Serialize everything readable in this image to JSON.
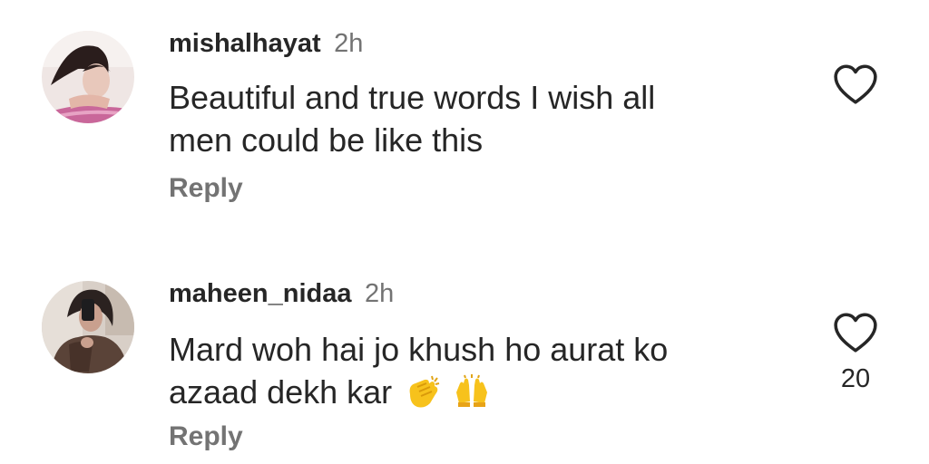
{
  "comments": [
    {
      "username": "mishalhayat",
      "time": "2h",
      "text_line1": "Beautiful and true words I wish all",
      "text_line2": "men could be like this",
      "reply_label": "Reply",
      "like_icon": "heart-outline-icon",
      "like_count": ""
    },
    {
      "username": "maheen_nidaa",
      "time": "2h",
      "text_line1": "Mard woh hai jo khush ho aurat ko",
      "text_line2": "azaad dekh kar",
      "emojis": [
        "clapping-hands-emoji",
        "raising-hands-emoji"
      ],
      "reply_label": "Reply",
      "like_icon": "heart-outline-icon",
      "like_count": "20"
    }
  ],
  "colors": {
    "primary_text": "#262626",
    "secondary_text": "#737373",
    "background": "#ffffff"
  }
}
